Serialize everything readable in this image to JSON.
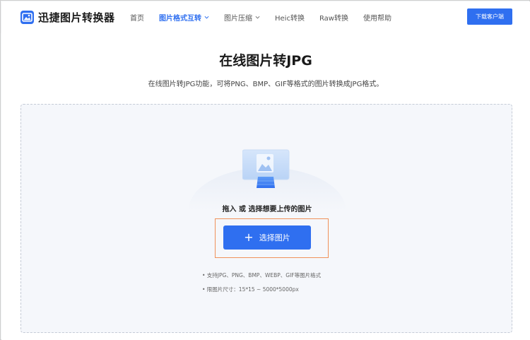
{
  "header": {
    "logo_text": "迅捷图片转换器",
    "nav": [
      {
        "label": "首页"
      },
      {
        "label": "图片格式互转"
      },
      {
        "label": "图片压缩"
      },
      {
        "label": "Heic转换"
      },
      {
        "label": "Raw转换"
      },
      {
        "label": "使用帮助"
      }
    ],
    "download_label": "下载客户端"
  },
  "main": {
    "title": "在线图片转JPG",
    "description": "在线图片转JPG功能，可将PNG、BMP、GIF等格式的图片转换成JPG格式。",
    "drop_text": "拖入 或 选择想要上传的图片",
    "select_button": "选择图片",
    "notes": [
      "• 支持JPG、PNG、BMP、WEBP、GIF等图片格式",
      "• 限图片尺寸：15*15 ~ 5000*5000px"
    ]
  },
  "colors": {
    "accent": "#2f6ff0",
    "highlight": "#f0915a"
  },
  "icons": [
    "logo-icon",
    "chevron-down-icon",
    "image-upload-icon",
    "plus-icon"
  ]
}
